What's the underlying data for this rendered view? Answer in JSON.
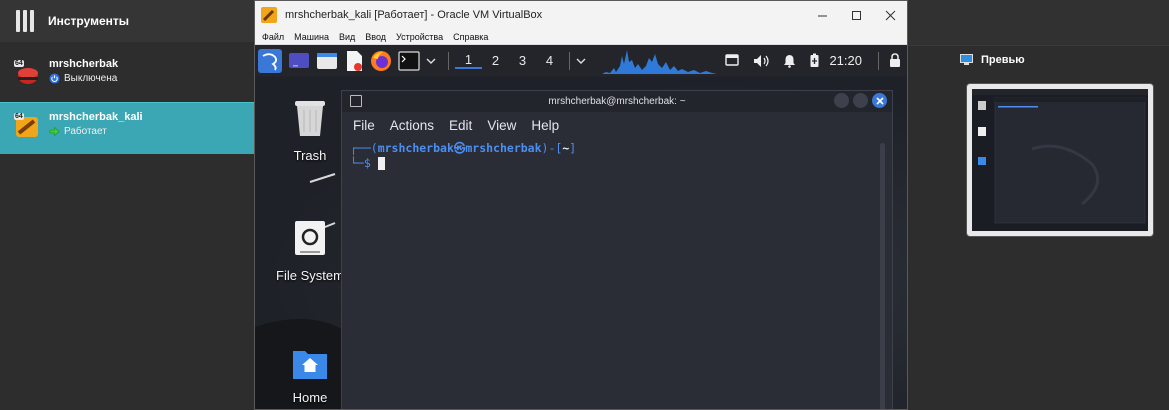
{
  "manager": {
    "tools_label": "Инструменты",
    "vms": [
      {
        "name": "mrshcherbak",
        "status": "Выключена",
        "os_badge": "64"
      },
      {
        "name": "mrshcherbak_kali",
        "status": "Работает",
        "os_badge": "64"
      }
    ],
    "preview_label": "Превью"
  },
  "vm_window": {
    "title": "mrshcherbak_kali [Работает] - Oracle VM VirtualBox",
    "menu": [
      "Файл",
      "Машина",
      "Вид",
      "Ввод",
      "Устройства",
      "Справка"
    ]
  },
  "kali_panel": {
    "workspaces": [
      "1",
      "2",
      "3",
      "4"
    ],
    "clock": "21:20"
  },
  "desktop": {
    "icons": [
      {
        "label": "Trash",
        "icon": "trash-icon"
      },
      {
        "label": "File System",
        "icon": "drive-icon"
      },
      {
        "label": "Home",
        "icon": "home-folder-icon"
      }
    ]
  },
  "terminal": {
    "title": "mrshcherbak@mrshcherbak: ~",
    "menu": [
      "File",
      "Actions",
      "Edit",
      "View",
      "Help"
    ],
    "prompt_open": "┌──(",
    "prompt_user": "mrshcherbak㉿mrshcherbak",
    "prompt_mid": ")-[",
    "prompt_dir": "~",
    "prompt_close": "]",
    "prompt_second": "└─$ "
  },
  "colors": {
    "selected_row": "#3ba7b4",
    "kali_accent": "#3a78d8",
    "prompt_blue": "#4c8ff0"
  }
}
